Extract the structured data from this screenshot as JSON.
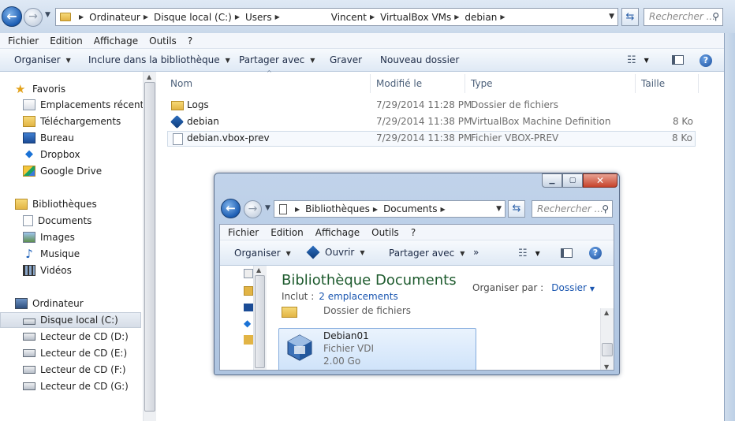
{
  "main": {
    "breadcrumbs": [
      "Ordinateur",
      "Disque local (C:)",
      "Users",
      "Vincent",
      "VirtualBox VMs",
      "debian"
    ],
    "search_placeholder": "Rechercher ...",
    "menu": [
      "Fichier",
      "Edition",
      "Affichage",
      "Outils",
      "?"
    ],
    "commands": {
      "organize": "Organiser",
      "include": "Inclure dans la bibliothèque",
      "share": "Partager avec",
      "burn": "Graver",
      "new_folder": "Nouveau dossier"
    },
    "nav": {
      "favorites": "Favoris",
      "favorite_items": [
        "Emplacements récents",
        "Téléchargements",
        "Bureau",
        "Dropbox",
        "Google Drive"
      ],
      "libraries": "Bibliothèques",
      "library_items": [
        "Documents",
        "Images",
        "Musique",
        "Vidéos"
      ],
      "computer": "Ordinateur",
      "computer_items": [
        "Disque local (C:)",
        "Lecteur de CD (D:)",
        "Lecteur de CD (E:)",
        "Lecteur de CD (F:)",
        "Lecteur de CD (G:)"
      ]
    },
    "columns": {
      "name": "Nom",
      "modified": "Modifié le",
      "type": "Type",
      "size": "Taille"
    },
    "files": [
      {
        "name": "Logs",
        "modified": "7/29/2014 11:28 PM",
        "type": "Dossier de fichiers",
        "size": "",
        "icon": "folder-icon"
      },
      {
        "name": "debian",
        "modified": "7/29/2014 11:38 PM",
        "type": "VirtualBox Machine Definition",
        "size": "8 Ko",
        "icon": "virtualbox-icon"
      },
      {
        "name": "debian.vbox-prev",
        "modified": "7/29/2014 11:38 PM",
        "type": "Fichier VBOX-PREV",
        "size": "8 Ko",
        "icon": "file-icon"
      }
    ]
  },
  "child": {
    "breadcrumbs": [
      "Bibliothèques",
      "Documents"
    ],
    "search_placeholder": "Rechercher ...",
    "menu": [
      "Fichier",
      "Edition",
      "Affichage",
      "Outils",
      "?"
    ],
    "commands": {
      "organize": "Organiser",
      "open": "Ouvrir",
      "share": "Partager avec",
      "more": "»"
    },
    "library_title": "Bibliothèque Documents",
    "include_label": "Inclut :",
    "include_link": "2 emplacements",
    "arrange_label": "Organiser par :",
    "arrange_value": "Dossier",
    "partial_item": "Dossier de fichiers",
    "selected_item": {
      "name": "Debian01",
      "type": "Fichier VDI",
      "size": "2.00 Go"
    }
  },
  "colors": {
    "accent": "#1a56b0",
    "library_title": "#1e5b2e",
    "chrome": "#c9d8ea"
  }
}
